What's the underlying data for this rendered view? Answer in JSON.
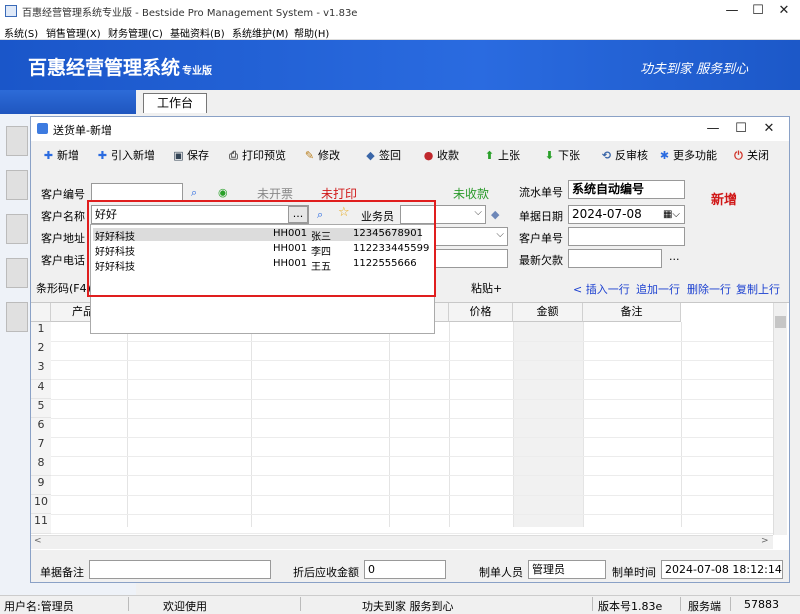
{
  "app": {
    "title": "百惠经营管理系统专业版 - Bestside Pro Management System - v1.83e",
    "menu": [
      "系统(S)",
      "销售管理(X)",
      "财务管理(C)",
      "基础资料(B)",
      "系统维护(M)",
      "帮助(H)"
    ],
    "brand": "百惠经营管理系统",
    "brand_suffix": "专业版",
    "slogan": "功夫到家 服务到心",
    "workspace_tab": "工作台"
  },
  "dialog": {
    "title": "送货单-新增",
    "toolbar": {
      "new": "新增",
      "import_new": "引入新增",
      "save": "保存",
      "print_preview": "打印预览",
      "edit": "修改",
      "sign_back": "签回",
      "collect": "收款",
      "prev": "上张",
      "next": "下张",
      "unaudit": "反审核",
      "more": "更多功能",
      "close": "关闭"
    },
    "form": {
      "customer_code_label": "客户编号",
      "customer_code_value": "",
      "not_invoiced": "未开票",
      "not_printed": "未打印",
      "not_collected": "未收款",
      "serial_label": "流水单号",
      "serial_value": "系统自动编号",
      "mode_badge": "新增",
      "customer_name_label": "客户名称",
      "customer_name_value": "好好",
      "more_btn": "...",
      "salesperson_label": "业务员",
      "salesperson_value": "",
      "doc_date_label": "单据日期",
      "doc_date_value": "2024-07-08",
      "customer_address_label": "客户地址",
      "customer_doc_label": "客户单号",
      "customer_doc_value": "",
      "customer_phone_label": "客户电话",
      "latest_debt_label": "最新欠款",
      "latest_debt_value": "",
      "latest_debt_more": "...",
      "barcode_label": "条形码(F4)",
      "paste_label": "粘贴+"
    },
    "row_actions": {
      "insert": "< 插入一行",
      "append": "追加一行",
      "delete": "删除一行",
      "copy": "复制上行"
    },
    "grid": {
      "headers": {
        "product": "产品编",
        "price": "价格",
        "amount": "金额",
        "note": "备注"
      },
      "rows": [
        "1",
        "2",
        "3",
        "4",
        "5",
        "6",
        "7",
        "8",
        "9",
        "10",
        "11"
      ]
    },
    "popup": {
      "rows": [
        {
          "name": "好好科技",
          "code": "HH001",
          "contact": "张三",
          "phone": "12345678901"
        },
        {
          "name": "好好科技",
          "code": "HH001",
          "contact": "李四",
          "phone": "112233445599"
        },
        {
          "name": "好好科技",
          "code": "HH001",
          "contact": "王五",
          "phone": "1122555666"
        }
      ]
    },
    "footer": {
      "doc_note_label": "单据备注",
      "doc_note_value": "",
      "discounted_label": "折后应收金额",
      "discounted_value": "0",
      "maker_label": "制单人员",
      "maker_value": "管理员",
      "make_time_label": "制单时间",
      "make_time_value": "2024-07-08 18:12:14"
    }
  },
  "statusbar": {
    "user": "用户名:管理员",
    "welcome": "欢迎使用",
    "slogan": "功夫到家 服务到心",
    "version": "版本号1.83e",
    "server": "服务端",
    "port": "57883"
  }
}
